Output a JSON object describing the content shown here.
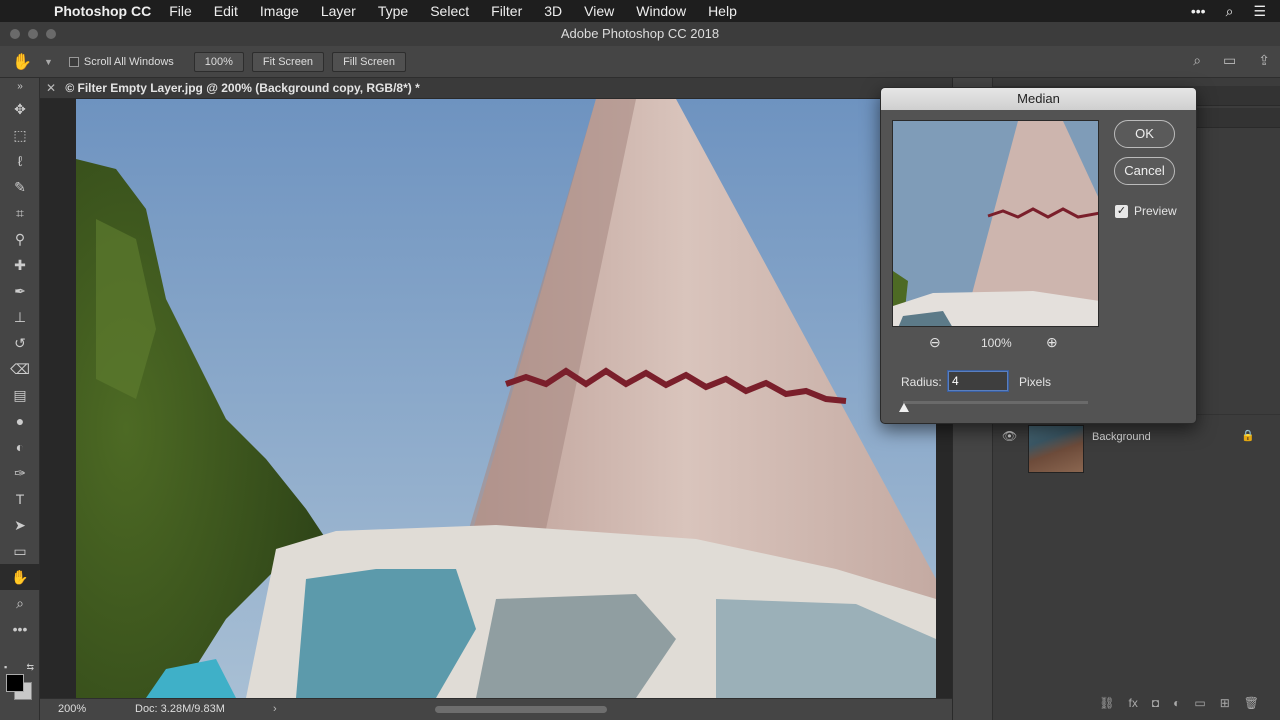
{
  "menubar": {
    "app": "Photoshop CC",
    "items": [
      "File",
      "Edit",
      "Image",
      "Layer",
      "Type",
      "Select",
      "Filter",
      "3D",
      "View",
      "Window",
      "Help"
    ]
  },
  "window": {
    "title": "Adobe Photoshop CC 2018"
  },
  "options": {
    "scroll_all": "Scroll All Windows",
    "zoom100": "100%",
    "fit_screen": "Fit Screen",
    "fill_screen": "Fill Screen"
  },
  "document": {
    "tab_title": "© Filter Empty Layer.jpg @ 200% (Background copy, RGB/8*) *",
    "zoom": "200%",
    "doc_info": "Doc: 3.28M/9.83M"
  },
  "layers": {
    "background_name": "Background"
  },
  "dialog": {
    "title": "Median",
    "ok": "OK",
    "cancel": "Cancel",
    "preview_label": "Preview",
    "preview_checked": true,
    "preview_zoom": "100%",
    "radius_label": "Radius:",
    "radius_value": "4",
    "radius_unit": "Pixels"
  }
}
